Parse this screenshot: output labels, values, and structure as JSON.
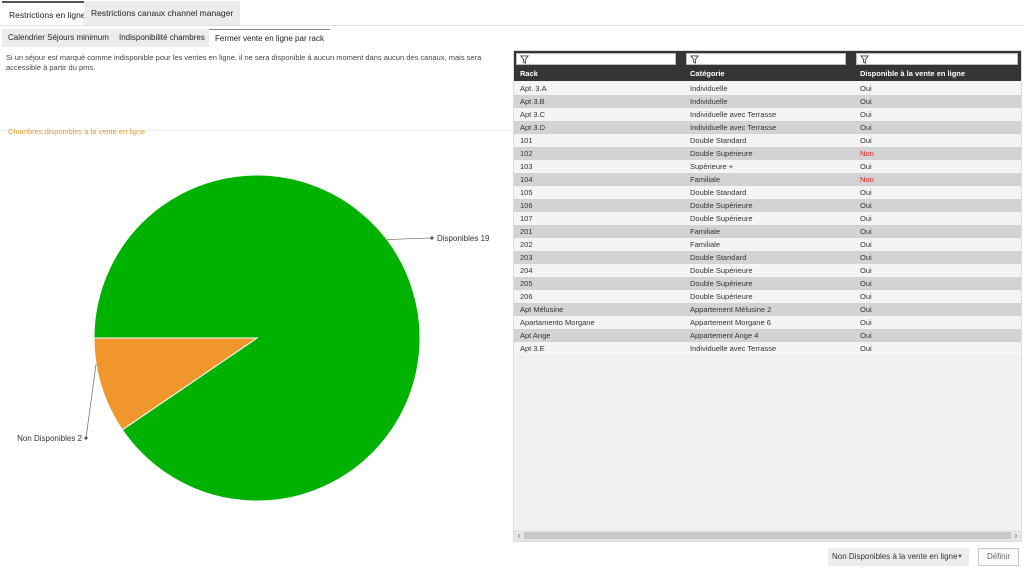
{
  "top_tabs": [
    "Restrictions en ligne",
    "Restrictions canaux channel manager"
  ],
  "sub_tabs": [
    "Calendrier Séjours minimum",
    "Indisponibilité chambres",
    "Fermer vente en ligne par rack"
  ],
  "info_text": "Si un séjour est marqué comme indisponible pour les ventes en ligne, il ne sera disponible à aucun moment dans aucun des canaux, mais sera accessible à partir du pms.",
  "chart_title": "Chambres disponibles à la vente en ligne",
  "chart_data": {
    "type": "pie",
    "title": "Chambres disponibles à la vente en ligne",
    "categories": [
      "Disponibles",
      "Non Disponibles"
    ],
    "values": [
      19,
      2
    ],
    "labels": [
      "Disponibles  19",
      "Non Disponibles 2"
    ],
    "colors": [
      "#00b200",
      "#f0962c"
    ]
  },
  "grid": {
    "columns": [
      "Rack",
      "Catégorie",
      "Disponible à la vente en ligne"
    ],
    "rows": [
      [
        "Apt. 3.A",
        "Individuelle",
        "Oui"
      ],
      [
        "Apt 3.B",
        "Individuelle",
        "Oui"
      ],
      [
        "Apt 3.C",
        "Individuelle avec Terrasse",
        "Oui"
      ],
      [
        "Apt 3.D",
        "Individuelle avec Terrasse",
        "Oui"
      ],
      [
        "101",
        "Double Standard",
        "Oui"
      ],
      [
        "102",
        "Double Supérieure",
        "Non"
      ],
      [
        "103",
        "Supérieure +",
        "Oui"
      ],
      [
        "104",
        "Familiale",
        "Non"
      ],
      [
        "105",
        "Double Standard",
        "Oui"
      ],
      [
        "106",
        "Double Supérieure",
        "Oui"
      ],
      [
        "107",
        "Double Supérieure",
        "Oui"
      ],
      [
        "201",
        "Familiale",
        "Oui"
      ],
      [
        "202",
        "Familiale",
        "Oui"
      ],
      [
        "203",
        "Double Standard",
        "Oui"
      ],
      [
        "204",
        "Double Supérieure",
        "Oui"
      ],
      [
        "205",
        "Double Supérieure",
        "Oui"
      ],
      [
        "206",
        "Double Supérieure",
        "Oui"
      ],
      [
        "Apt Mélusine",
        "Appartement Mélusine 2",
        "Oui"
      ],
      [
        "Apartamento Morgane",
        "Appartement Morgane 6",
        "Oui"
      ],
      [
        "Apt Ange",
        "Appartement Ange 4",
        "Oui"
      ],
      [
        "Apt 3.E",
        "Individuelle avec Terrasse",
        "Oui"
      ]
    ]
  },
  "footer": {
    "filter_value": "Non Disponibles à la vente en ligne",
    "define_label": "Définir"
  },
  "colors": {
    "no": "#e0201b",
    "header_bg": "#353535",
    "accent": "#f09a2c"
  },
  "icons": {
    "filter": "filter-icon",
    "dropdown": "chevron-down-icon",
    "scroll_left": "arrow-left-icon",
    "scroll_right": "arrow-right-icon"
  }
}
